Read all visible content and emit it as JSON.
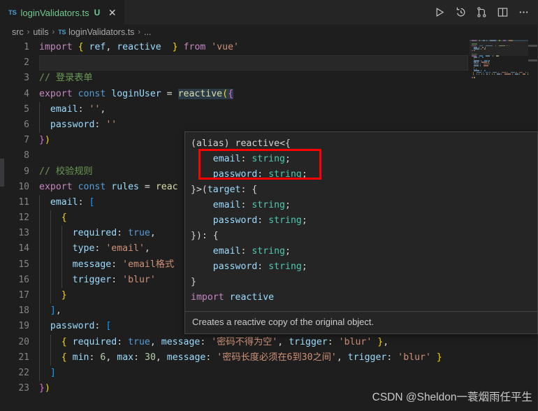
{
  "tab": {
    "file_icon": "TS",
    "label": "loginValidators.ts",
    "status": "U",
    "close": "✕"
  },
  "toolbar": {
    "run_label": "run-icon",
    "history_label": "history-icon",
    "source_control_label": "source-control-icon",
    "split_label": "split-editor-icon",
    "more_label": "⋯"
  },
  "breadcrumb": {
    "items": [
      "src",
      "utils",
      "loginValidators.ts",
      "..."
    ],
    "ts_icon": "TS",
    "separator": "›"
  },
  "editor": {
    "lines": [
      {
        "num": "1",
        "tokens": [
          {
            "t": "import",
            "c": "k"
          },
          {
            "t": " ",
            "c": "p"
          },
          {
            "t": "{",
            "c": "br1"
          },
          {
            "t": " ",
            "c": "p"
          },
          {
            "t": "ref",
            "c": "v"
          },
          {
            "t": ",",
            "c": "p"
          },
          {
            "t": " ",
            "c": "p"
          },
          {
            "t": "reactive",
            "c": "v"
          },
          {
            "t": "  ",
            "c": "p"
          },
          {
            "t": "}",
            "c": "br1"
          },
          {
            "t": " ",
            "c": "p"
          },
          {
            "t": "from",
            "c": "k"
          },
          {
            "t": " ",
            "c": "p"
          },
          {
            "t": "'vue'",
            "c": "s"
          }
        ]
      },
      {
        "num": "2",
        "tokens": []
      },
      {
        "num": "3",
        "tokens": [
          {
            "t": "// 登录表单",
            "c": "c"
          }
        ]
      },
      {
        "num": "4",
        "tokens": [
          {
            "t": "export",
            "c": "k"
          },
          {
            "t": " ",
            "c": "p"
          },
          {
            "t": "const",
            "c": "kb"
          },
          {
            "t": " ",
            "c": "p"
          },
          {
            "t": "loginUser",
            "c": "v"
          },
          {
            "t": " ",
            "c": "p"
          },
          {
            "t": "=",
            "c": "p"
          },
          {
            "t": " ",
            "c": "p"
          },
          {
            "t": "reactive",
            "c": "fn hl"
          },
          {
            "t": "(",
            "c": "br1 hl"
          },
          {
            "t": "{",
            "c": "br2 hl"
          }
        ]
      },
      {
        "num": "5",
        "tokens": [
          {
            "t": "  ",
            "c": "p"
          },
          {
            "t": "email",
            "c": "v"
          },
          {
            "t": ":",
            "c": "p"
          },
          {
            "t": " ",
            "c": "p"
          },
          {
            "t": "''",
            "c": "s"
          },
          {
            "t": ",",
            "c": "p"
          }
        ]
      },
      {
        "num": "6",
        "tokens": [
          {
            "t": "  ",
            "c": "p"
          },
          {
            "t": "password",
            "c": "v"
          },
          {
            "t": ":",
            "c": "p"
          },
          {
            "t": " ",
            "c": "p"
          },
          {
            "t": "''",
            "c": "s"
          }
        ]
      },
      {
        "num": "7",
        "tokens": [
          {
            "t": "}",
            "c": "br2"
          },
          {
            "t": ")",
            "c": "br1"
          }
        ]
      },
      {
        "num": "8",
        "tokens": []
      },
      {
        "num": "9",
        "tokens": [
          {
            "t": "// 校验规则",
            "c": "c"
          }
        ]
      },
      {
        "num": "10",
        "tokens": [
          {
            "t": "export",
            "c": "k"
          },
          {
            "t": " ",
            "c": "p"
          },
          {
            "t": "const",
            "c": "kb"
          },
          {
            "t": " ",
            "c": "p"
          },
          {
            "t": "rules",
            "c": "v"
          },
          {
            "t": " ",
            "c": "p"
          },
          {
            "t": "=",
            "c": "p"
          },
          {
            "t": " ",
            "c": "p"
          },
          {
            "t": "reac",
            "c": "fn"
          }
        ]
      },
      {
        "num": "11",
        "tokens": [
          {
            "t": "  ",
            "c": "p"
          },
          {
            "t": "email",
            "c": "v"
          },
          {
            "t": ":",
            "c": "p"
          },
          {
            "t": " ",
            "c": "p"
          },
          {
            "t": "[",
            "c": "br3"
          }
        ]
      },
      {
        "num": "12",
        "tokens": [
          {
            "t": "    ",
            "c": "p"
          },
          {
            "t": "{",
            "c": "br1"
          }
        ]
      },
      {
        "num": "13",
        "tokens": [
          {
            "t": "      ",
            "c": "p"
          },
          {
            "t": "required",
            "c": "v"
          },
          {
            "t": ":",
            "c": "p"
          },
          {
            "t": " ",
            "c": "p"
          },
          {
            "t": "true",
            "c": "kb"
          },
          {
            "t": ",",
            "c": "p"
          }
        ]
      },
      {
        "num": "14",
        "tokens": [
          {
            "t": "      ",
            "c": "p"
          },
          {
            "t": "type",
            "c": "v"
          },
          {
            "t": ":",
            "c": "p"
          },
          {
            "t": " ",
            "c": "p"
          },
          {
            "t": "'email'",
            "c": "s"
          },
          {
            "t": ",",
            "c": "p"
          }
        ]
      },
      {
        "num": "15",
        "tokens": [
          {
            "t": "      ",
            "c": "p"
          },
          {
            "t": "message",
            "c": "v"
          },
          {
            "t": ":",
            "c": "p"
          },
          {
            "t": " ",
            "c": "p"
          },
          {
            "t": "'email格式",
            "c": "s"
          }
        ]
      },
      {
        "num": "16",
        "tokens": [
          {
            "t": "      ",
            "c": "p"
          },
          {
            "t": "trigger",
            "c": "v"
          },
          {
            "t": ":",
            "c": "p"
          },
          {
            "t": " ",
            "c": "p"
          },
          {
            "t": "'blur'",
            "c": "s"
          }
        ]
      },
      {
        "num": "17",
        "tokens": [
          {
            "t": "    ",
            "c": "p"
          },
          {
            "t": "}",
            "c": "br1"
          }
        ]
      },
      {
        "num": "18",
        "tokens": [
          {
            "t": "  ",
            "c": "p"
          },
          {
            "t": "]",
            "c": "br3"
          },
          {
            "t": ",",
            "c": "p"
          }
        ]
      },
      {
        "num": "19",
        "tokens": [
          {
            "t": "  ",
            "c": "p"
          },
          {
            "t": "password",
            "c": "v"
          },
          {
            "t": ":",
            "c": "p"
          },
          {
            "t": " ",
            "c": "p"
          },
          {
            "t": "[",
            "c": "br3"
          }
        ]
      },
      {
        "num": "20",
        "tokens": [
          {
            "t": "    ",
            "c": "p"
          },
          {
            "t": "{",
            "c": "br1"
          },
          {
            "t": " ",
            "c": "p"
          },
          {
            "t": "required",
            "c": "v"
          },
          {
            "t": ":",
            "c": "p"
          },
          {
            "t": " ",
            "c": "p"
          },
          {
            "t": "true",
            "c": "kb"
          },
          {
            "t": ",",
            "c": "p"
          },
          {
            "t": " ",
            "c": "p"
          },
          {
            "t": "message",
            "c": "v"
          },
          {
            "t": ":",
            "c": "p"
          },
          {
            "t": " ",
            "c": "p"
          },
          {
            "t": "'密码不得为空'",
            "c": "s"
          },
          {
            "t": ",",
            "c": "p"
          },
          {
            "t": " ",
            "c": "p"
          },
          {
            "t": "trigger",
            "c": "v"
          },
          {
            "t": ":",
            "c": "p"
          },
          {
            "t": " ",
            "c": "p"
          },
          {
            "t": "'blur'",
            "c": "s"
          },
          {
            "t": " ",
            "c": "p"
          },
          {
            "t": "}",
            "c": "br1"
          },
          {
            "t": ",",
            "c": "p"
          }
        ]
      },
      {
        "num": "21",
        "tokens": [
          {
            "t": "    ",
            "c": "p"
          },
          {
            "t": "{",
            "c": "br1"
          },
          {
            "t": " ",
            "c": "p"
          },
          {
            "t": "min",
            "c": "v"
          },
          {
            "t": ":",
            "c": "p"
          },
          {
            "t": " ",
            "c": "p"
          },
          {
            "t": "6",
            "c": "n"
          },
          {
            "t": ",",
            "c": "p"
          },
          {
            "t": " ",
            "c": "p"
          },
          {
            "t": "max",
            "c": "v"
          },
          {
            "t": ":",
            "c": "p"
          },
          {
            "t": " ",
            "c": "p"
          },
          {
            "t": "30",
            "c": "n"
          },
          {
            "t": ",",
            "c": "p"
          },
          {
            "t": " ",
            "c": "p"
          },
          {
            "t": "message",
            "c": "v"
          },
          {
            "t": ":",
            "c": "p"
          },
          {
            "t": " ",
            "c": "p"
          },
          {
            "t": "'密码长度必须在6到30之间'",
            "c": "s"
          },
          {
            "t": ",",
            "c": "p"
          },
          {
            "t": " ",
            "c": "p"
          },
          {
            "t": "trigger",
            "c": "v"
          },
          {
            "t": ":",
            "c": "p"
          },
          {
            "t": " ",
            "c": "p"
          },
          {
            "t": "'blur'",
            "c": "s"
          },
          {
            "t": " ",
            "c": "p"
          },
          {
            "t": "}",
            "c": "br1"
          }
        ]
      },
      {
        "num": "22",
        "tokens": [
          {
            "t": "  ",
            "c": "p"
          },
          {
            "t": "]",
            "c": "br3"
          }
        ]
      },
      {
        "num": "23",
        "tokens": [
          {
            "t": "}",
            "c": "br2"
          },
          {
            "t": ")",
            "c": "br1"
          }
        ]
      }
    ]
  },
  "tooltip": {
    "signature_lines": [
      [
        {
          "t": "(alias) ",
          "c": "p"
        },
        {
          "t": "reactive",
          "c": "p"
        },
        {
          "t": "<{",
          "c": "p"
        }
      ],
      [
        {
          "t": "    ",
          "c": "p"
        },
        {
          "t": "email",
          "c": "v"
        },
        {
          "t": ": ",
          "c": "p"
        },
        {
          "t": "string",
          "c": "tt-type"
        },
        {
          "t": ";",
          "c": "p"
        }
      ],
      [
        {
          "t": "    ",
          "c": "p"
        },
        {
          "t": "password",
          "c": "v"
        },
        {
          "t": ": ",
          "c": "p"
        },
        {
          "t": "string",
          "c": "tt-type"
        },
        {
          "t": ";",
          "c": "p"
        }
      ],
      [
        {
          "t": "}>(",
          "c": "p"
        },
        {
          "t": "target",
          "c": "v"
        },
        {
          "t": ": {",
          "c": "p"
        }
      ],
      [
        {
          "t": "    ",
          "c": "p"
        },
        {
          "t": "email",
          "c": "v"
        },
        {
          "t": ": ",
          "c": "p"
        },
        {
          "t": "string",
          "c": "tt-type"
        },
        {
          "t": ";",
          "c": "p"
        }
      ],
      [
        {
          "t": "    ",
          "c": "p"
        },
        {
          "t": "password",
          "c": "v"
        },
        {
          "t": ": ",
          "c": "p"
        },
        {
          "t": "string",
          "c": "tt-type"
        },
        {
          "t": ";",
          "c": "p"
        }
      ],
      [
        {
          "t": "}): {",
          "c": "p"
        }
      ],
      [
        {
          "t": "    ",
          "c": "p"
        },
        {
          "t": "email",
          "c": "v"
        },
        {
          "t": ": ",
          "c": "p"
        },
        {
          "t": "string",
          "c": "tt-type"
        },
        {
          "t": ";",
          "c": "p"
        }
      ],
      [
        {
          "t": "    ",
          "c": "p"
        },
        {
          "t": "password",
          "c": "v"
        },
        {
          "t": ": ",
          "c": "p"
        },
        {
          "t": "string",
          "c": "tt-type"
        },
        {
          "t": ";",
          "c": "p"
        }
      ],
      [
        {
          "t": "}",
          "c": "p"
        }
      ],
      [
        {
          "t": "import",
          "c": "k"
        },
        {
          "t": " ",
          "c": "p"
        },
        {
          "t": "reactive",
          "c": "v"
        }
      ]
    ],
    "description": "Creates a reactive copy of the original object."
  },
  "annotation": {
    "color": "#ff0000"
  },
  "watermark": {
    "text": "CSDN @Sheldon一蓑烟雨任平生"
  },
  "minimap": {
    "rows": 24
  }
}
